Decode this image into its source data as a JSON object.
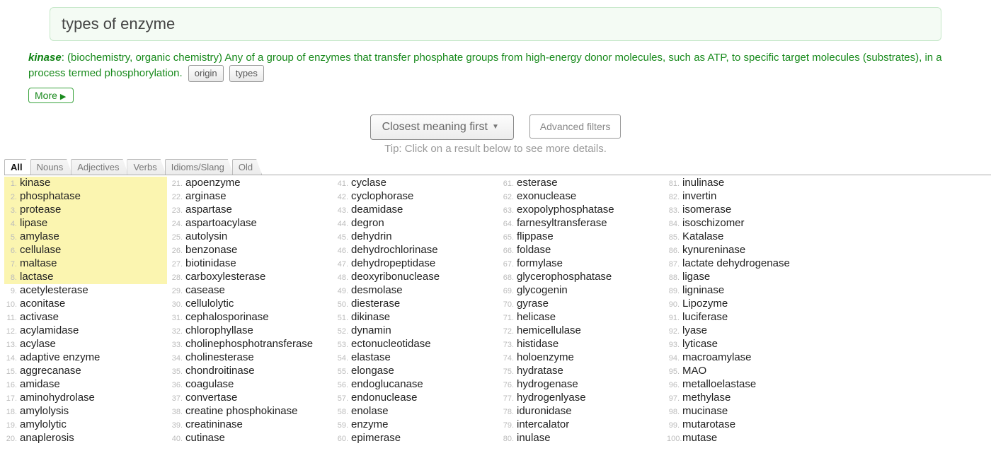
{
  "search": {
    "query": "types of enzyme"
  },
  "definition": {
    "headword": "kinase",
    "text": ": (biochemistry, organic chemistry) Any of a group of enzymes that transfer phosphate groups from high-energy donor molecules, such as ATP, to specific target molecules (substrates), in a process termed phosphorylation.",
    "origin_btn": "origin",
    "types_btn": "types",
    "more_btn": "More"
  },
  "controls": {
    "sort_label": "Closest meaning first",
    "advanced_label": "Advanced filters",
    "tip": "Tip: Click on a result below to see more details."
  },
  "tabs": [
    "All",
    "Nouns",
    "Adjectives",
    "Verbs",
    "Idioms/Slang",
    "Old"
  ],
  "active_tab": "All",
  "highlight_count": 8,
  "results": [
    "kinase",
    "phosphatase",
    "protease",
    "lipase",
    "amylase",
    "cellulase",
    "maltase",
    "lactase",
    "acetylesterase",
    "aconitase",
    "activase",
    "acylamidase",
    "acylase",
    "adaptive enzyme",
    "aggrecanase",
    "amidase",
    "aminohydrolase",
    "amylolysis",
    "amylolytic",
    "anaplerosis",
    "apoenzyme",
    "arginase",
    "aspartase",
    "aspartoacylase",
    "autolysin",
    "benzonase",
    "biotinidase",
    "carboxylesterase",
    "casease",
    "cellulolytic",
    "cephalosporinase",
    "chlorophyllase",
    "cholinephosphotransferase",
    "cholinesterase",
    "chondroitinase",
    "coagulase",
    "convertase",
    "creatine phosphokinase",
    "creatininase",
    "cutinase",
    "cyclase",
    "cyclophorase",
    "deamidase",
    "degron",
    "dehydrin",
    "dehydrochlorinase",
    "dehydropeptidase",
    "deoxyribonuclease",
    "desmolase",
    "diesterase",
    "dikinase",
    "dynamin",
    "ectonucleotidase",
    "elastase",
    "elongase",
    "endoglucanase",
    "endonuclease",
    "enolase",
    "enzyme",
    "epimerase",
    "esterase",
    "exonuclease",
    "exopolyphosphatase",
    "farnesyltransferase",
    "flippase",
    "foldase",
    "formylase",
    "glycerophosphatase",
    "glycogenin",
    "gyrase",
    "helicase",
    "hemicellulase",
    "histidase",
    "holoenzyme",
    "hydratase",
    "hydrogenase",
    "hydrogenlyase",
    "iduronidase",
    "intercalator",
    "inulase",
    "inulinase",
    "invertin",
    "isomerase",
    "isoschizomer",
    "Katalase",
    "kynureninase",
    "lactate dehydrogenase",
    "ligase",
    "ligninase",
    "Lipozyme",
    "luciferase",
    "lyase",
    "lyticase",
    "macroamylase",
    "MAO",
    "metalloelastase",
    "methylase",
    "mucinase",
    "mutarotase",
    "mutase"
  ]
}
